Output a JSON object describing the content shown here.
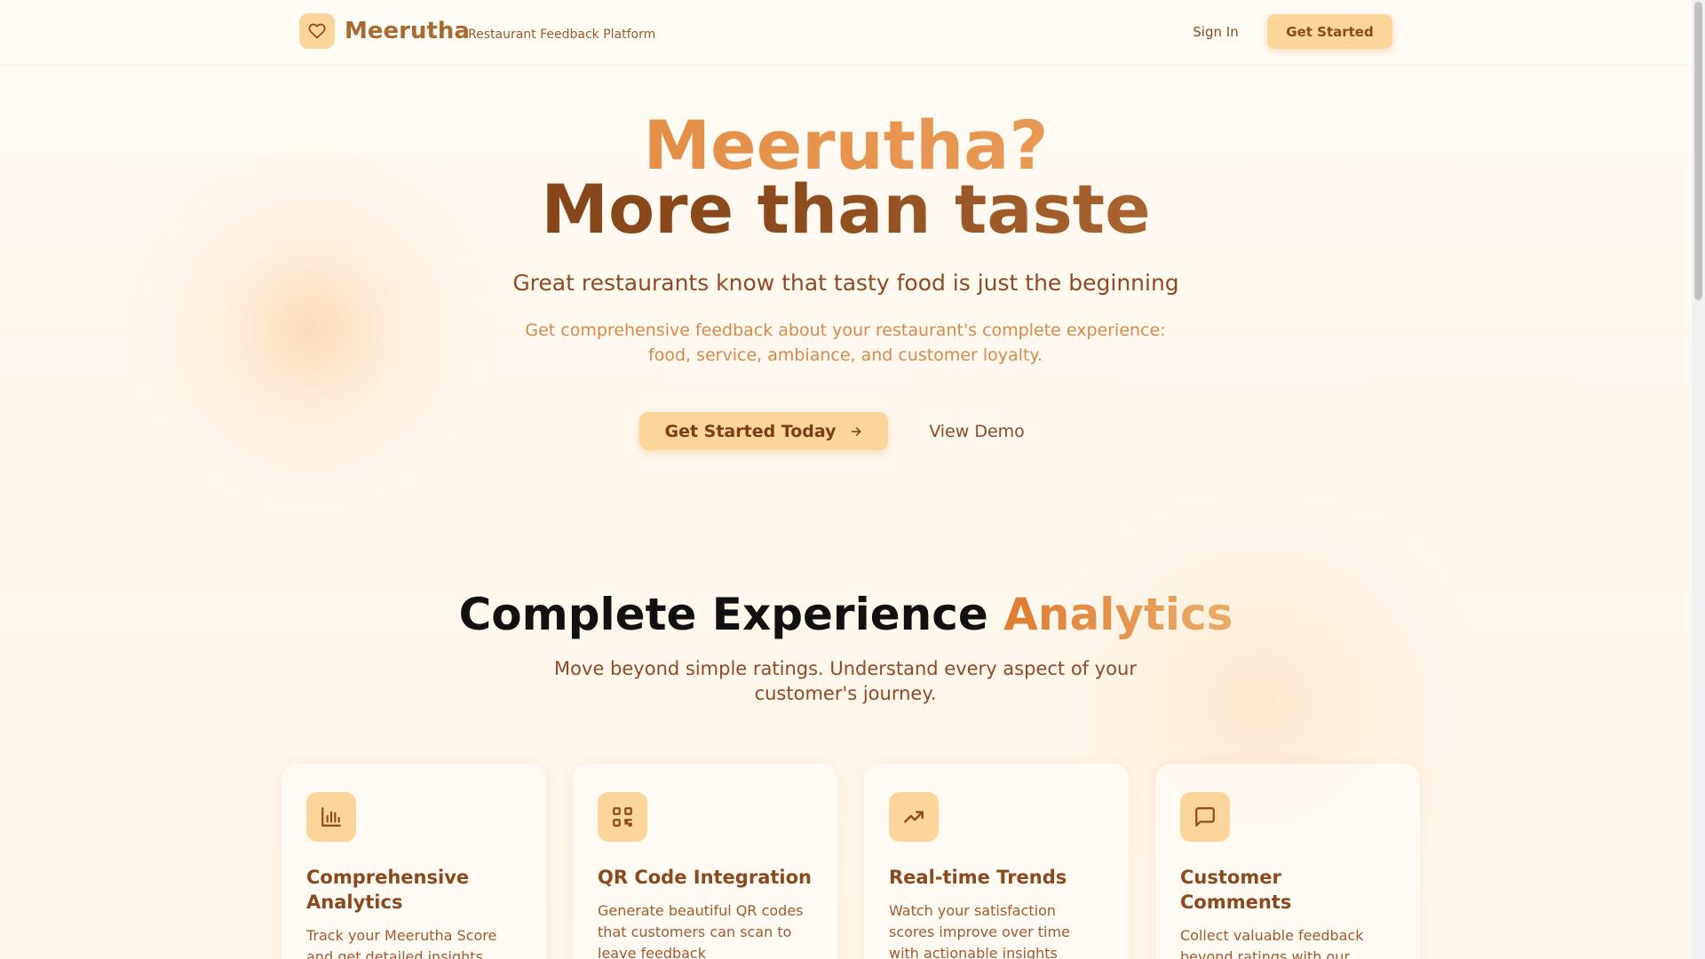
{
  "header": {
    "brand": "Meerutha",
    "tagline": "Restaurant Feedback Platform",
    "sign_in": "Sign In",
    "get_started": "Get Started"
  },
  "hero": {
    "line1": "Meerutha?",
    "line2": "More than taste",
    "subtitle": "Great restaurants know that tasty food is just the beginning",
    "description": "Get comprehensive feedback about your restaurant's complete experience: food, service, ambiance, and customer loyalty.",
    "cta": "Get Started Today",
    "demo": "View Demo"
  },
  "features": {
    "title": "Complete Experience",
    "title_accent": "Analytics",
    "subtitle": "Move beyond simple ratings. Understand every aspect of your customer's journey.",
    "cards": [
      {
        "icon": "bar-chart-icon",
        "title": "Comprehensive Analytics",
        "desc": "Track your Meerutha Score and get detailed insights"
      },
      {
        "icon": "qr-code-icon",
        "title": "QR Code Integration",
        "desc": "Generate beautiful QR codes that customers can scan to leave feedback"
      },
      {
        "icon": "trending-up-icon",
        "title": "Real-time Trends",
        "desc": "Watch your satisfaction scores improve over time with actionable insights"
      },
      {
        "icon": "message-square-icon",
        "title": "Customer Comments",
        "desc": "Collect valuable feedback beyond ratings with our"
      }
    ]
  },
  "colors": {
    "accent": "#e08a3c",
    "brown": "#8a4a1e",
    "button_bg": "#fcd59a"
  }
}
